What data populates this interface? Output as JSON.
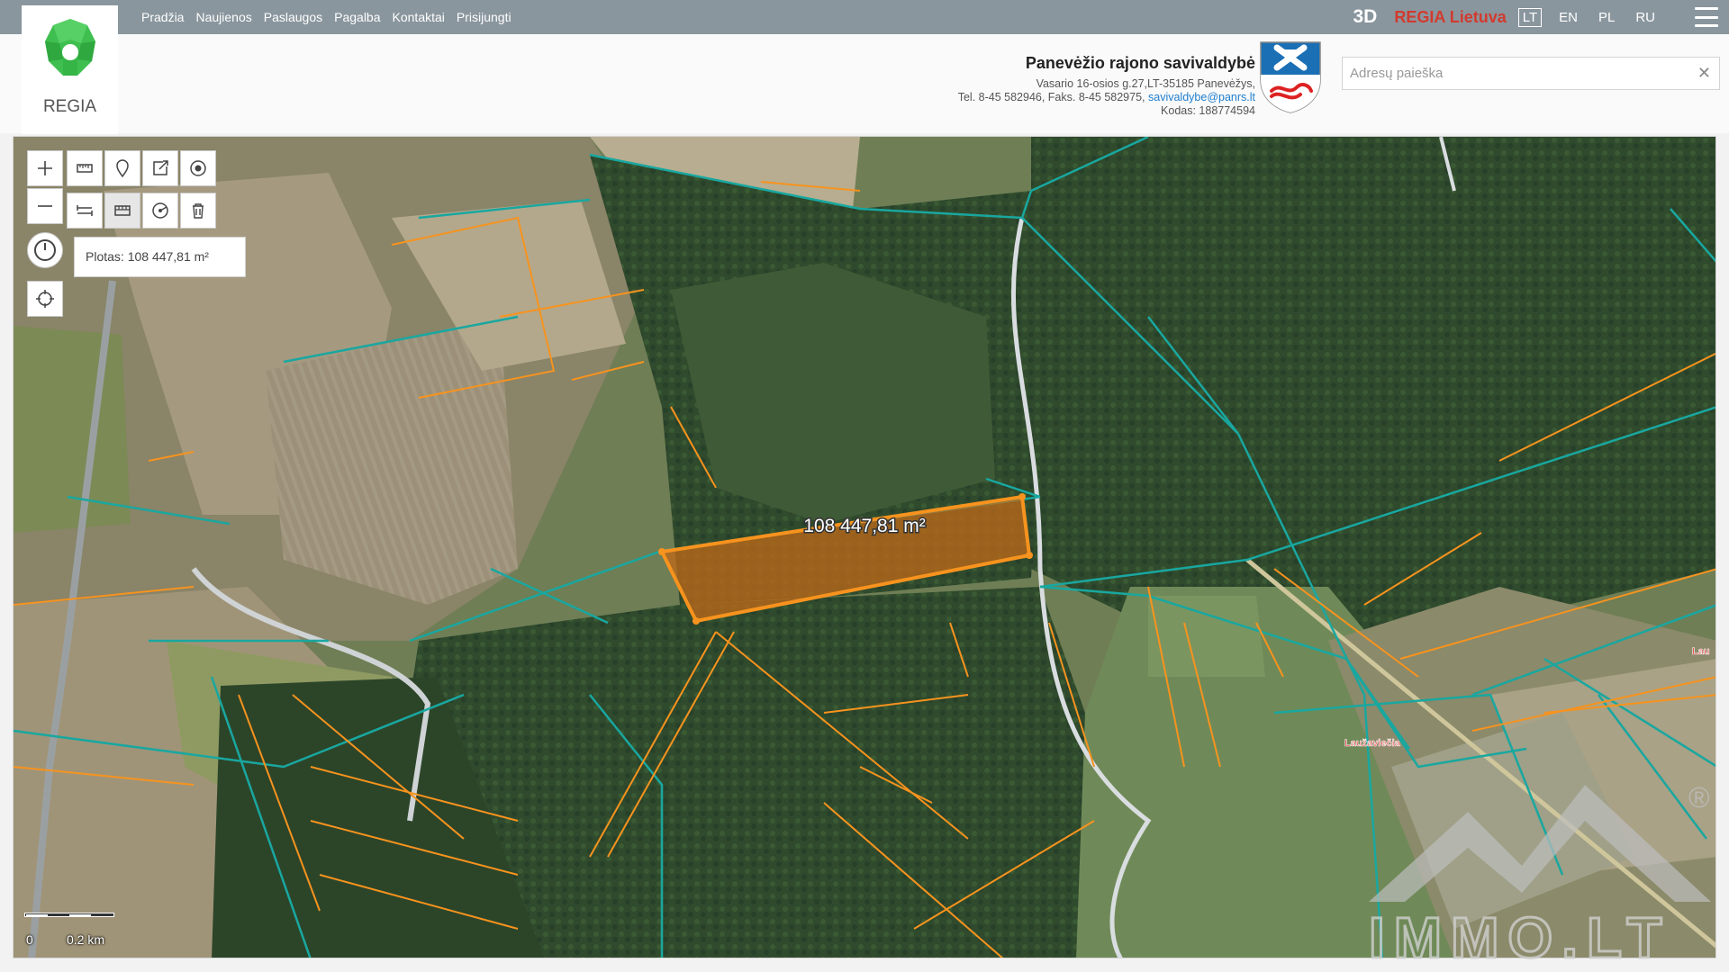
{
  "nav": {
    "links": [
      "Pradžia",
      "Naujienos",
      "Paslaugos",
      "Pagalba",
      "Kontaktai",
      "Prisijungti"
    ],
    "btn3d": "3D",
    "regia_lt": "REGIA Lietuva",
    "languages": [
      "LT",
      "EN",
      "PL",
      "RU"
    ],
    "active_language": "LT"
  },
  "logo": {
    "text": "REGIA"
  },
  "municipality": {
    "title": "Panevėžio rajono savivaldybė",
    "address": "Vasario 16-osios g.27,LT-35185 Panevėžys,",
    "phone": "Tel. 8-45 582946, Faks. 8-45 582975,",
    "email": "savivaldybe@panrs.lt",
    "code": "Kodas: 188774594"
  },
  "search": {
    "placeholder": "Adresų paieška",
    "value": ""
  },
  "map": {
    "measurement_label": "108 447,81 m²",
    "popup_text": "Plotas: 108 447,81 m²",
    "place_label": "Laužaviečia",
    "edge_label": "Lau",
    "scale": {
      "zero": "0",
      "distance": "0.2 km"
    },
    "parcel_color": "#f7931e",
    "boundary_color": "#19a7a0",
    "road_color": "#d9dde0"
  },
  "watermark": {
    "text": "IMMO.LT",
    "registered": "®"
  },
  "colors": {
    "topbar": "#8a969e",
    "brand_red": "#d23a2e",
    "logo_green": "#3fbf4f"
  }
}
